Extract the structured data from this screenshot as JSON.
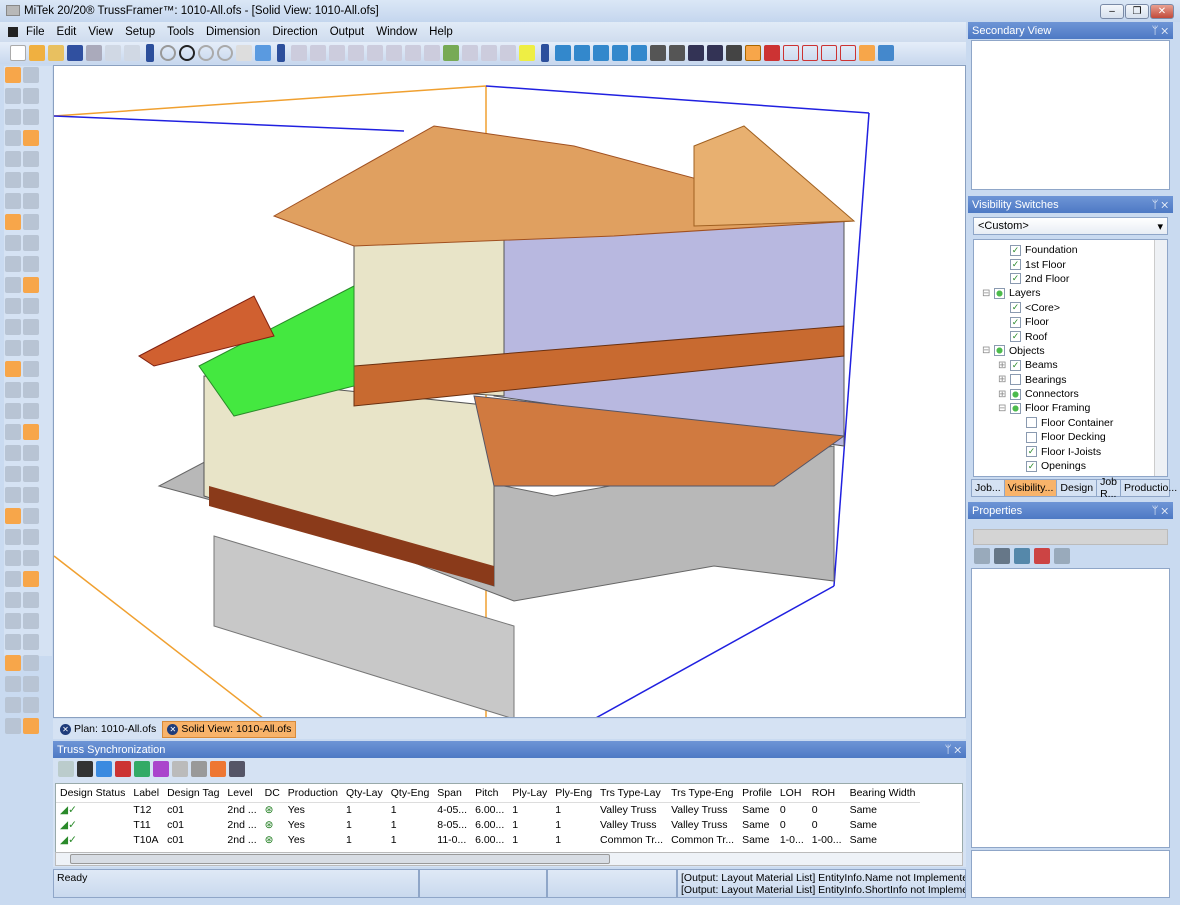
{
  "window": {
    "title": "MiTek 20/20® TrussFramer™: 1010-All.ofs - [Solid View: 1010-All.ofs]",
    "min": "–",
    "restore": "❐",
    "close": "✕"
  },
  "menu": [
    "File",
    "Edit",
    "View",
    "Setup",
    "Tools",
    "Dimension",
    "Direction",
    "Output",
    "Window",
    "Help"
  ],
  "doc_tabs": [
    {
      "label": "Plan: 1010-All.ofs",
      "active": false
    },
    {
      "label": "Solid View: 1010-All.ofs",
      "active": true
    }
  ],
  "truss_panel": {
    "title": "Truss Synchronization",
    "columns": [
      "Design Status",
      "Label",
      "Design Tag",
      "Level",
      "DC",
      "Production",
      "Qty-Lay",
      "Qty-Eng",
      "Span",
      "Pitch",
      "Ply-Lay",
      "Ply-Eng",
      "Trs Type-Lay",
      "Trs Type-Eng",
      "Profile",
      "LOH",
      "ROH",
      "Bearing Width"
    ],
    "rows": [
      [
        "",
        "T12",
        "c01",
        "2nd ...",
        "",
        "Yes",
        "1",
        "1",
        "4-05...",
        "6.00...",
        "1",
        "1",
        "Valley Truss",
        "Valley Truss",
        "Same",
        "0",
        "0",
        "Same"
      ],
      [
        "",
        "T11",
        "c01",
        "2nd ...",
        "",
        "Yes",
        "1",
        "1",
        "8-05...",
        "6.00...",
        "1",
        "1",
        "Valley Truss",
        "Valley Truss",
        "Same",
        "0",
        "0",
        "Same"
      ],
      [
        "",
        "T10A",
        "c01",
        "2nd ...",
        "",
        "Yes",
        "1",
        "1",
        "11-0...",
        "6.00...",
        "1",
        "1",
        "Common Tr...",
        "Common Tr...",
        "Same",
        "1-0...",
        "1-00...",
        "Same"
      ]
    ]
  },
  "status": {
    "ready": "Ready",
    "msg1": "[Output: Layout Material List] EntityInfo.Name not Implemented",
    "msg2": "[Output: Layout Material List]  EntityInfo.ShortInfo not Implement"
  },
  "secondary_view": {
    "title": "Secondary View"
  },
  "visibility": {
    "title": "Visibility Switches",
    "preset": "<Custom>",
    "items": [
      {
        "label": "Foundation",
        "indent": 2,
        "state": "checked"
      },
      {
        "label": "1st Floor",
        "indent": 2,
        "state": "checked"
      },
      {
        "label": "2nd Floor",
        "indent": 2,
        "state": "checked"
      },
      {
        "label": "Layers",
        "indent": 1,
        "state": "partial",
        "expander": "⊟"
      },
      {
        "label": "<Core>",
        "indent": 2,
        "state": "checked"
      },
      {
        "label": "Floor",
        "indent": 2,
        "state": "checked"
      },
      {
        "label": "Roof",
        "indent": 2,
        "state": "checked"
      },
      {
        "label": "Objects",
        "indent": 1,
        "state": "partial",
        "expander": "⊟"
      },
      {
        "label": "Beams",
        "indent": 2,
        "state": "checked",
        "expander": "⊞"
      },
      {
        "label": "Bearings",
        "indent": 2,
        "state": "unchecked",
        "expander": "⊞"
      },
      {
        "label": "Connectors",
        "indent": 2,
        "state": "partial",
        "expander": "⊞"
      },
      {
        "label": "Floor Framing",
        "indent": 2,
        "state": "partial",
        "expander": "⊟"
      },
      {
        "label": "Floor Container",
        "indent": 3,
        "state": "unchecked"
      },
      {
        "label": "Floor Decking",
        "indent": 3,
        "state": "unchecked"
      },
      {
        "label": "Floor I-Joists",
        "indent": 3,
        "state": "checked"
      },
      {
        "label": "Openings",
        "indent": 3,
        "state": "checked"
      }
    ]
  },
  "right_tabs": [
    {
      "label": "Job...",
      "active": false
    },
    {
      "label": "Visibility...",
      "active": true
    },
    {
      "label": "Design",
      "active": false
    },
    {
      "label": "Job R...",
      "active": false
    },
    {
      "label": "Productio...",
      "active": false
    }
  ],
  "properties": {
    "title": "Properties"
  },
  "panel_buttons": {
    "pin": "📌",
    "close": "✕"
  }
}
